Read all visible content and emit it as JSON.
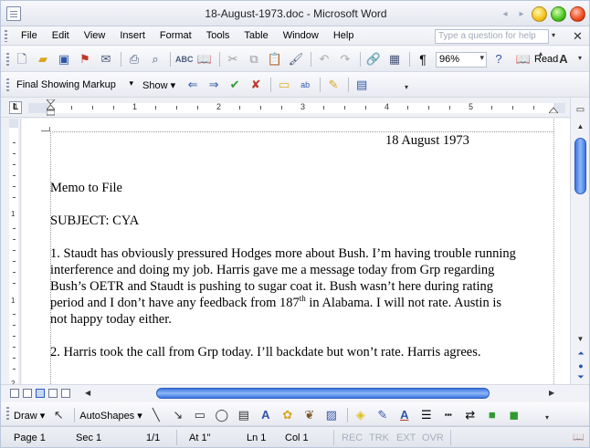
{
  "window": {
    "title": "18-August-1973.doc - Microsoft Word"
  },
  "menu": {
    "items": [
      "File",
      "Edit",
      "View",
      "Insert",
      "Format",
      "Tools",
      "Table",
      "Window",
      "Help"
    ],
    "help_placeholder": "Type a question for help"
  },
  "standard_toolbar": {
    "zoom": "96%",
    "read_label": "Read"
  },
  "reviewing_toolbar": {
    "markup_mode": "Final Showing Markup",
    "show_label": "Show"
  },
  "ruler": {
    "numbers": [
      "1",
      "1",
      "2",
      "3",
      "4",
      "5"
    ]
  },
  "vruler": {
    "numbers": [
      "1",
      "1",
      "2"
    ]
  },
  "document": {
    "date": "18 August 1973",
    "memo_to": "Memo to File",
    "subject": "SUBJECT:  CYA",
    "para1_line1": "1.  Staudt has obviously pressured Hodges more about Bush.  I’m having trouble running",
    "para1_line2": "interference and doing my job.  Harris gave me a message today from Grp regarding",
    "para1_line3": "Bush’s OETR and Staudt is pushing to sugar coat it.  Bush wasn’t here during rating",
    "para1_line4_a": "period and I don’t have any feedback from 187",
    "para1_line4_sup": "th",
    "para1_line4_b": " in Alabama.  I will not rate.  Austin is",
    "para1_line5": "not happy today either.",
    "para2": "2.  Harris took the call from Grp today.  I’ll backdate but won’t rate.  Harris agrees."
  },
  "drawing_toolbar": {
    "draw_label": "Draw",
    "autoshapes_label": "AutoShapes"
  },
  "status": {
    "page": "Page  1",
    "sec": "Sec  1",
    "pages": "1/1",
    "at": "At  1\"",
    "ln": "Ln  1",
    "col": "Col  1",
    "rec": "REC",
    "trk": "TRK",
    "ext": "EXT",
    "ovr": "OVR"
  }
}
